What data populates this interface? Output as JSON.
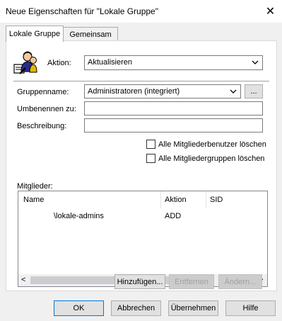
{
  "window": {
    "title": "Neue Eigenschaften für \"Lokale Gruppe\"",
    "close_glyph": "✕"
  },
  "tabs": [
    {
      "label": "Lokale Gruppe",
      "active": true
    },
    {
      "label": "Gemeinsam",
      "active": false
    }
  ],
  "action": {
    "label": "Aktion:",
    "value": "Aktualisieren"
  },
  "form": {
    "group_name_label": "Gruppenname:",
    "group_name_value": "Administratoren (integriert)",
    "browse_label": "...",
    "rename_label": "Umbenennen zu:",
    "rename_value": "",
    "description_label": "Beschreibung:",
    "description_value": ""
  },
  "checkboxes": [
    {
      "label": "Alle Mitgliederbenutzer löschen",
      "checked": false
    },
    {
      "label": "Alle Mitgliedergruppen löschen",
      "checked": false
    }
  ],
  "members": {
    "label": "Mitglieder:",
    "columns": [
      "Name",
      "Aktion",
      "SID"
    ],
    "rows": [
      {
        "name": "\\lokale-admins",
        "action": "ADD",
        "sid": ""
      }
    ],
    "scroll_left": "<",
    "scroll_right": ">"
  },
  "member_buttons": {
    "add": "Hinzufügen...",
    "remove": "Entfernen",
    "change": "Ändern..."
  },
  "dialog_buttons": {
    "ok": "OK",
    "cancel": "Abbrechen",
    "apply": "Übernehmen",
    "help": "Hilfe"
  },
  "colors": {
    "accent": "#0078d7",
    "disabled_text": "#a0a0a0"
  },
  "icons": {
    "action_icon": "group-users-icon",
    "dropdown": "chevron-down-icon"
  }
}
